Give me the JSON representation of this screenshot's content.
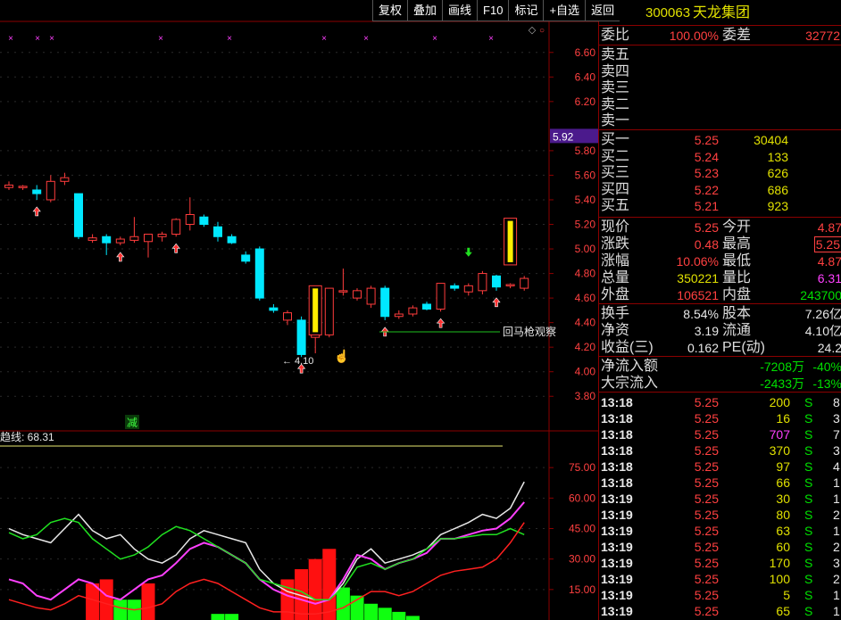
{
  "toolbar": {
    "buttons": [
      "复权",
      "叠加",
      "画线",
      "F10",
      "标记",
      "+自选",
      "返回"
    ]
  },
  "chart": {
    "price_ticks": [
      "6.60",
      "6.40",
      "6.20",
      "5.80",
      "5.60",
      "5.40",
      "5.20",
      "5.00",
      "4.80",
      "4.60",
      "4.40",
      "4.20",
      "4.00",
      "3.80"
    ],
    "current_price_tag": "5.92",
    "low_annotation": "4.10",
    "line_annotation": "回马枪观察",
    "reduce_marker": "减",
    "indicator_label": "趋线: 68.31",
    "indicator_ticks": [
      "75.00",
      "60.00",
      "45.00",
      "30.00",
      "15.00"
    ]
  },
  "chart_data": {
    "type": "candlestick",
    "price_ylim": [
      3.7,
      6.7
    ],
    "candles": [
      {
        "o": 5.5,
        "h": 5.55,
        "l": 5.48,
        "c": 5.52
      },
      {
        "o": 5.5,
        "h": 5.52,
        "l": 5.48,
        "c": 5.51
      },
      {
        "o": 5.48,
        "h": 5.52,
        "l": 5.4,
        "c": 5.45
      },
      {
        "o": 5.4,
        "h": 5.6,
        "l": 5.38,
        "c": 5.55
      },
      {
        "o": 5.55,
        "h": 5.62,
        "l": 5.52,
        "c": 5.58
      },
      {
        "o": 5.45,
        "h": 5.45,
        "l": 5.08,
        "c": 5.1
      },
      {
        "o": 5.07,
        "h": 5.12,
        "l": 5.05,
        "c": 5.09
      },
      {
        "o": 5.1,
        "h": 5.12,
        "l": 4.95,
        "c": 5.05
      },
      {
        "o": 5.05,
        "h": 5.1,
        "l": 5.03,
        "c": 5.08
      },
      {
        "o": 5.07,
        "h": 5.26,
        "l": 5.05,
        "c": 5.1
      },
      {
        "o": 5.06,
        "h": 5.12,
        "l": 4.93,
        "c": 5.12
      },
      {
        "o": 5.1,
        "h": 5.14,
        "l": 5.06,
        "c": 5.12
      },
      {
        "o": 5.12,
        "h": 5.25,
        "l": 5.1,
        "c": 5.24
      },
      {
        "o": 5.2,
        "h": 5.42,
        "l": 5.15,
        "c": 5.28
      },
      {
        "o": 5.26,
        "h": 5.28,
        "l": 5.18,
        "c": 5.2
      },
      {
        "o": 5.18,
        "h": 5.22,
        "l": 5.06,
        "c": 5.1
      },
      {
        "o": 5.1,
        "h": 5.12,
        "l": 5.04,
        "c": 5.05
      },
      {
        "o": 4.95,
        "h": 4.98,
        "l": 4.88,
        "c": 4.9
      },
      {
        "o": 5.0,
        "h": 5.02,
        "l": 4.58,
        "c": 4.6
      },
      {
        "o": 4.52,
        "h": 4.55,
        "l": 4.48,
        "c": 4.5
      },
      {
        "o": 4.42,
        "h": 4.5,
        "l": 4.38,
        "c": 4.48
      },
      {
        "o": 4.42,
        "h": 4.45,
        "l": 4.12,
        "c": 4.14
      },
      {
        "o": 4.28,
        "h": 4.36,
        "l": 4.15,
        "c": 4.32
      },
      {
        "o": 4.3,
        "h": 4.68,
        "l": 4.28,
        "c": 4.68
      },
      {
        "o": 4.66,
        "h": 4.84,
        "l": 4.62,
        "c": 4.66
      },
      {
        "o": 4.6,
        "h": 4.68,
        "l": 4.58,
        "c": 4.66
      },
      {
        "o": 4.55,
        "h": 4.7,
        "l": 4.52,
        "c": 4.68
      },
      {
        "o": 4.68,
        "h": 4.7,
        "l": 4.42,
        "c": 4.45
      },
      {
        "o": 4.45,
        "h": 4.5,
        "l": 4.43,
        "c": 4.47
      },
      {
        "o": 4.47,
        "h": 4.54,
        "l": 4.45,
        "c": 4.52
      },
      {
        "o": 4.55,
        "h": 4.57,
        "l": 4.5,
        "c": 4.51
      },
      {
        "o": 4.51,
        "h": 4.72,
        "l": 4.49,
        "c": 4.72
      },
      {
        "o": 4.7,
        "h": 4.72,
        "l": 4.66,
        "c": 4.68
      },
      {
        "o": 4.65,
        "h": 4.72,
        "l": 4.62,
        "c": 4.7
      },
      {
        "o": 4.66,
        "h": 4.82,
        "l": 4.63,
        "c": 4.8
      },
      {
        "o": 4.78,
        "h": 4.79,
        "l": 4.66,
        "c": 4.69
      },
      {
        "o": 4.7,
        "h": 4.72,
        "l": 4.68,
        "c": 4.71
      },
      {
        "o": 4.68,
        "h": 4.78,
        "l": 4.66,
        "c": 4.76
      }
    ],
    "indicator": {
      "ylim": [
        0,
        90
      ],
      "series": [
        {
          "name": "白线",
          "values": [
            45,
            42,
            40,
            38,
            45,
            52,
            44,
            40,
            42,
            35,
            30,
            28,
            32,
            40,
            44,
            42,
            40,
            38,
            25,
            18,
            14,
            12,
            10,
            10,
            18,
            30,
            35,
            28,
            30,
            32,
            35,
            42,
            45,
            48,
            52,
            50,
            55,
            68
          ]
        },
        {
          "name": "紫线",
          "values": [
            20,
            18,
            12,
            10,
            15,
            20,
            18,
            12,
            10,
            15,
            20,
            22,
            28,
            35,
            38,
            36,
            32,
            28,
            20,
            15,
            12,
            10,
            8,
            10,
            20,
            32,
            30,
            25,
            28,
            30,
            33,
            40,
            40,
            42,
            44,
            45,
            50,
            58
          ]
        },
        {
          "name": "绿线",
          "values": [
            43,
            40,
            42,
            48,
            50,
            48,
            40,
            35,
            30,
            32,
            36,
            42,
            46,
            44,
            40,
            36,
            32,
            28,
            20,
            18,
            16,
            14,
            10,
            10,
            16,
            26,
            28,
            25,
            28,
            30,
            35,
            40,
            40,
            41,
            42,
            42,
            45,
            42
          ]
        },
        {
          "name": "红线",
          "values": [
            10,
            8,
            6,
            5,
            8,
            12,
            10,
            8,
            6,
            5,
            6,
            8,
            14,
            18,
            20,
            18,
            14,
            10,
            6,
            4,
            4,
            3,
            3,
            4,
            6,
            10,
            14,
            14,
            12,
            14,
            18,
            22,
            24,
            25,
            26,
            30,
            38,
            48
          ]
        }
      ],
      "bars": [
        0,
        0,
        0,
        0,
        0,
        0,
        18,
        20,
        -10,
        -10,
        18,
        0,
        0,
        0,
        0,
        -3,
        -3,
        0,
        0,
        0,
        20,
        25,
        30,
        35,
        -16,
        -12,
        -8,
        -6,
        -4,
        -2,
        0,
        0,
        0,
        0,
        0,
        0,
        0,
        0
      ]
    }
  },
  "panel": {
    "code": "300063",
    "name": "天龙集团",
    "wei_bi_label": "委比",
    "wei_bi": "100.00%",
    "wei_cha_label": "委差",
    "wei_cha": "32772",
    "sell": [
      {
        "label": "卖五",
        "price": "",
        "vol": ""
      },
      {
        "label": "卖四",
        "price": "",
        "vol": ""
      },
      {
        "label": "卖三",
        "price": "",
        "vol": ""
      },
      {
        "label": "卖二",
        "price": "",
        "vol": ""
      },
      {
        "label": "卖一",
        "price": "",
        "vol": ""
      }
    ],
    "buy": [
      {
        "label": "买一",
        "price": "5.25",
        "vol": "30404"
      },
      {
        "label": "买二",
        "price": "5.24",
        "vol": "133"
      },
      {
        "label": "买三",
        "price": "5.23",
        "vol": "626"
      },
      {
        "label": "买四",
        "price": "5.22",
        "vol": "686"
      },
      {
        "label": "买五",
        "price": "5.21",
        "vol": "923"
      }
    ],
    "quote": [
      {
        "l1": "现价",
        "v1": "5.25",
        "c1": "red",
        "l2": "今开",
        "v2": "4.87",
        "c2": "red",
        "box": false
      },
      {
        "l1": "涨跌",
        "v1": "0.48",
        "c1": "red",
        "l2": "最高",
        "v2": "5.25",
        "c2": "red",
        "box": true
      },
      {
        "l1": "涨幅",
        "v1": "10.06%",
        "c1": "red",
        "l2": "最低",
        "v2": "4.87",
        "c2": "red",
        "box": false
      },
      {
        "l1": "总量",
        "v1": "350221",
        "c1": "yel",
        "l2": "量比",
        "v2": "6.31",
        "c2": "mag",
        "box": false
      },
      {
        "l1": "外盘",
        "v1": "106521",
        "c1": "red",
        "l2": "内盘",
        "v2": "243700",
        "c2": "green",
        "box": false
      }
    ],
    "fund": [
      {
        "l1": "换手",
        "v1": "8.54%",
        "l2": "股本",
        "v2": "7.26亿"
      },
      {
        "l1": "净资",
        "v1": "3.19",
        "l2": "流通",
        "v2": "4.10亿"
      },
      {
        "l1": "收益(三)",
        "v1": "0.162",
        "l2": "PE(动)",
        "v2": "24.2"
      }
    ],
    "flow": [
      {
        "label": "净流入额",
        "value": "-7208万",
        "pct": "-40%"
      },
      {
        "label": "大宗流入",
        "value": "-2433万",
        "pct": "-13%"
      }
    ],
    "ticks": [
      {
        "t": "13:18",
        "p": "5.25",
        "v": "200",
        "vc": "yel",
        "d": "S",
        "n": "8"
      },
      {
        "t": "13:18",
        "p": "5.25",
        "v": "16",
        "vc": "yel",
        "d": "S",
        "n": "3"
      },
      {
        "t": "13:18",
        "p": "5.25",
        "v": "707",
        "vc": "mag",
        "d": "S",
        "n": "7"
      },
      {
        "t": "13:18",
        "p": "5.25",
        "v": "370",
        "vc": "yel",
        "d": "S",
        "n": "3"
      },
      {
        "t": "13:18",
        "p": "5.25",
        "v": "97",
        "vc": "yel",
        "d": "S",
        "n": "4"
      },
      {
        "t": "13:18",
        "p": "5.25",
        "v": "66",
        "vc": "yel",
        "d": "S",
        "n": "1"
      },
      {
        "t": "13:19",
        "p": "5.25",
        "v": "30",
        "vc": "yel",
        "d": "S",
        "n": "1"
      },
      {
        "t": "13:19",
        "p": "5.25",
        "v": "80",
        "vc": "yel",
        "d": "S",
        "n": "2"
      },
      {
        "t": "13:19",
        "p": "5.25",
        "v": "63",
        "vc": "yel",
        "d": "S",
        "n": "1"
      },
      {
        "t": "13:19",
        "p": "5.25",
        "v": "60",
        "vc": "yel",
        "d": "S",
        "n": "2"
      },
      {
        "t": "13:19",
        "p": "5.25",
        "v": "170",
        "vc": "yel",
        "d": "S",
        "n": "3"
      },
      {
        "t": "13:19",
        "p": "5.25",
        "v": "100",
        "vc": "yel",
        "d": "S",
        "n": "2"
      },
      {
        "t": "13:19",
        "p": "5.25",
        "v": "5",
        "vc": "yel",
        "d": "S",
        "n": "1"
      },
      {
        "t": "13:19",
        "p": "5.25",
        "v": "65",
        "vc": "yel",
        "d": "S",
        "n": "1"
      }
    ]
  },
  "colors": {
    "up": "#ff3c3c",
    "down": "#00e8ff",
    "panel_border": "#8b0000",
    "accent": "#ffd700"
  }
}
